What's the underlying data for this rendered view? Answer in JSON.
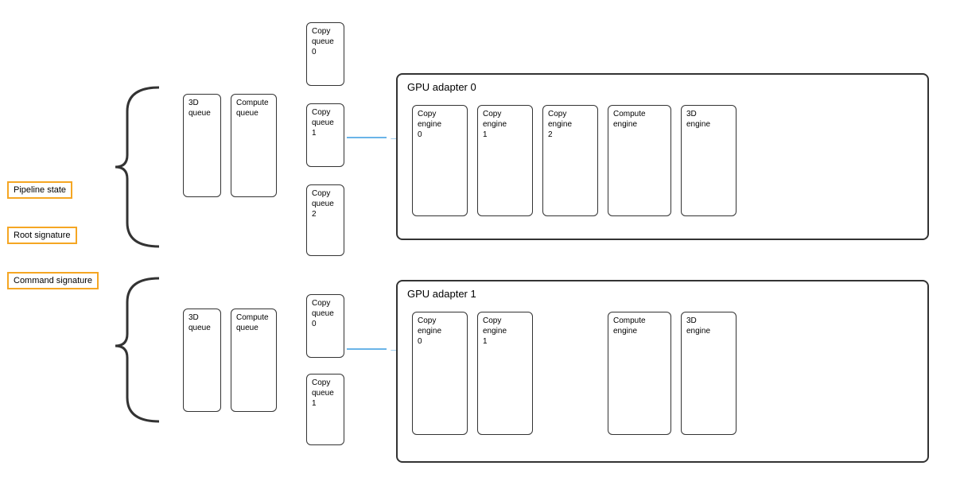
{
  "labels": {
    "pipeline_state": "Pipeline state",
    "root_signature": "Root signature",
    "command_signature": "Command signature"
  },
  "gpu_adapter_0": {
    "title": "GPU adapter 0",
    "engines": [
      {
        "label": "Copy\nengine\n0"
      },
      {
        "label": "Copy\nengine\n1"
      },
      {
        "label": "Copy\nengine\n2"
      },
      {
        "label": "Compute\nengine"
      },
      {
        "label": "3D\nengine"
      }
    ]
  },
  "gpu_adapter_1": {
    "title": "GPU adapter 1",
    "engines": [
      {
        "label": "Copy\nengine\n0"
      },
      {
        "label": "Copy\nengine\n1"
      },
      {
        "label": "Compute\nengine"
      },
      {
        "label": "3D\nengine"
      }
    ]
  },
  "top_group": {
    "queues_left": [
      {
        "label": "3D\nqueue"
      },
      {
        "label": "Compute\nqueue"
      }
    ],
    "queues_right": [
      {
        "label": "Copy\nqueue\n0"
      },
      {
        "label": "Copy\nqueue\n1"
      },
      {
        "label": "Copy\nqueue\n2"
      }
    ]
  },
  "bottom_group": {
    "queues_left": [
      {
        "label": "3D\nqueue"
      },
      {
        "label": "Compute\nqueue"
      }
    ],
    "queues_right": [
      {
        "label": "Copy\nqueue\n0"
      },
      {
        "label": "Copy\nqueue\n1"
      }
    ]
  }
}
